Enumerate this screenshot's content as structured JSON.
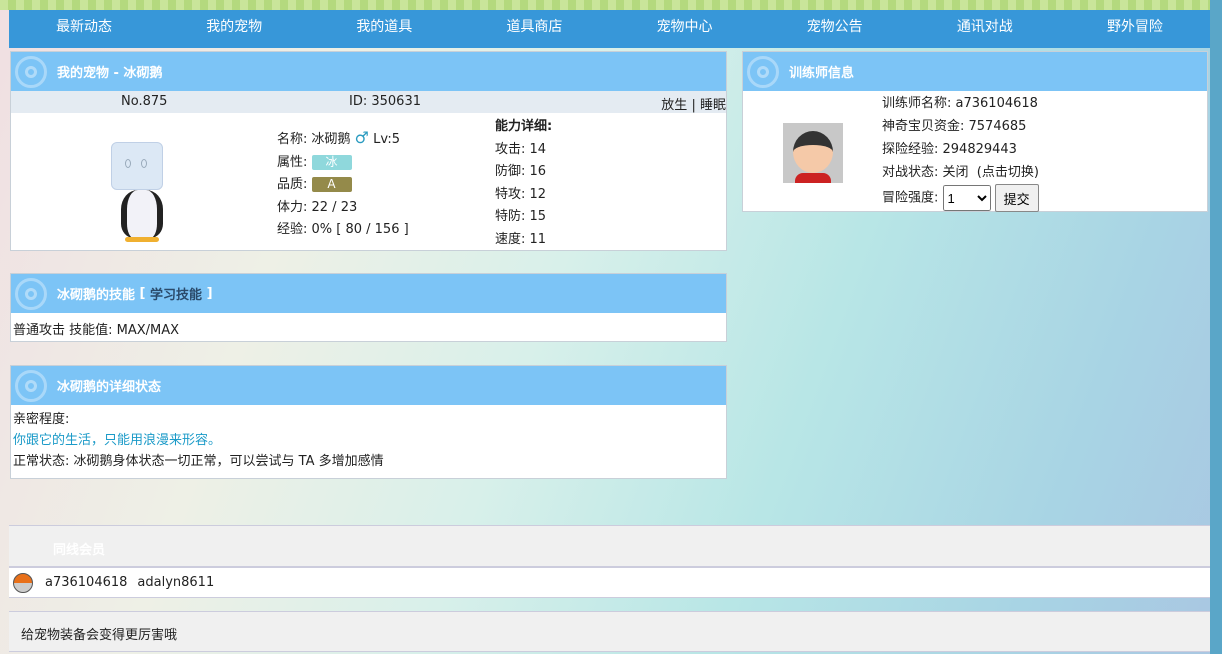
{
  "nav": [
    "最新动态",
    "我的宠物",
    "我的道具",
    "道具商店",
    "宠物中心",
    "宠物公告",
    "通讯对战",
    "野外冒险"
  ],
  "pet": {
    "title": "我的宠物 - 冰砌鹅",
    "no": "No.875",
    "id": "ID: 350631",
    "release": "放生",
    "sep": "|",
    "sleep": "睡眠",
    "name_label": "名称: ",
    "name": "冰砌鹅",
    "gender_icon": "male-icon",
    "level": "Lv:5",
    "attr_label": "属性: ",
    "attr": "冰",
    "attr_color": "#8fd8dc",
    "quality_label": "品质: ",
    "quality": "A",
    "quality_color": "#948a4a",
    "hp": "体力: 22 / 23",
    "exp": "经验: 0% [ 80 / 156 ]",
    "stats_title": "能力详细:",
    "stats": [
      "攻击: 14",
      "防御: 16",
      "特攻: 12",
      "特防: 15",
      "速度: 11"
    ]
  },
  "skills": {
    "title": "冰砌鹅的技能",
    "bracket_open": "[",
    "learn": "学习技能",
    "bracket_close": "]",
    "item": "普通攻击 技能值: MAX/MAX"
  },
  "status": {
    "title": "冰砌鹅的详细状态",
    "intimacy_label": "亲密程度:",
    "intimacy": "你跟它的生活，只能用浪漫来形容。",
    "normal": "正常状态: 冰砌鹅身体状态一切正常，可以尝试与 TA 多增加感情"
  },
  "trainer": {
    "title": "训练师信息",
    "name": "训练师名称: a736104618",
    "money": "神奇宝贝资金: 7574685",
    "exp": "探险经验: 294829443",
    "battle_label": "对战状态: ",
    "battle": "关闭",
    "toggle": "(点击切换)",
    "intensity_label": "冒险强度: ",
    "intensity": "1",
    "submit": "提交"
  },
  "online": {
    "title": "同线会员",
    "members": [
      "a736104618",
      "adalyn8611"
    ]
  },
  "tip": "给宠物装备会变得更厉害哦"
}
